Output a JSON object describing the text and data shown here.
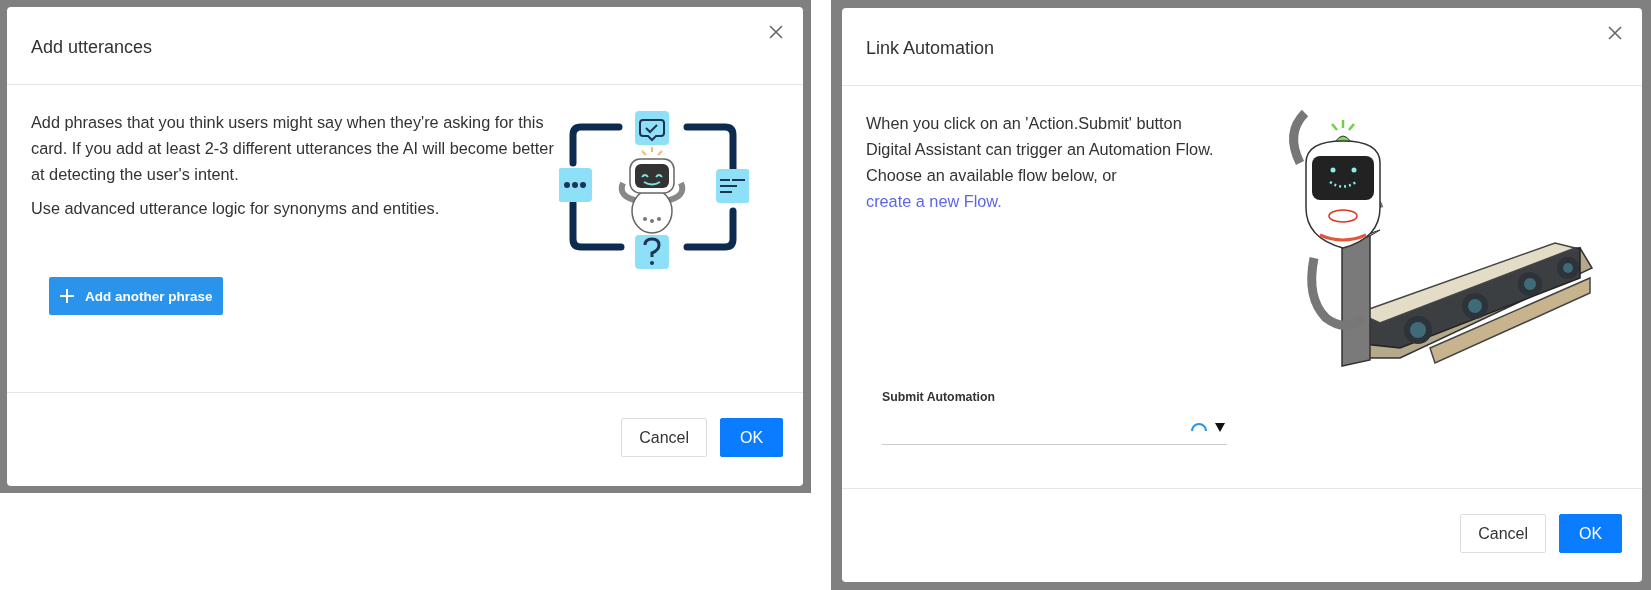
{
  "dialogs": [
    {
      "kind": "utterances",
      "title": "Add utterances",
      "paragraphs": [
        "Add phrases that you think users might say when they're asking for this card. If you add at least 2-3 different utterances the AI will become better at detecting the user's intent.",
        "Use advanced utterance logic for synonyms and entities."
      ],
      "add_button": "Add another phrase",
      "buttons": [
        {
          "label": "Cancel",
          "primary": false
        },
        {
          "label": "OK",
          "primary": true
        }
      ]
    },
    {
      "kind": "automation",
      "title": "Link Automation",
      "lines": [
        "When you click on an 'Action.Submit' button",
        "Digital Assistant can trigger an Automation Flow.",
        "Choose an available flow below, or"
      ],
      "link": "create a new Flow.",
      "field": {
        "label": "Submit Automation",
        "loading": true
      },
      "buttons": [
        {
          "label": "Cancel",
          "primary": false
        },
        {
          "label": "OK",
          "primary": true
        }
      ]
    }
  ]
}
